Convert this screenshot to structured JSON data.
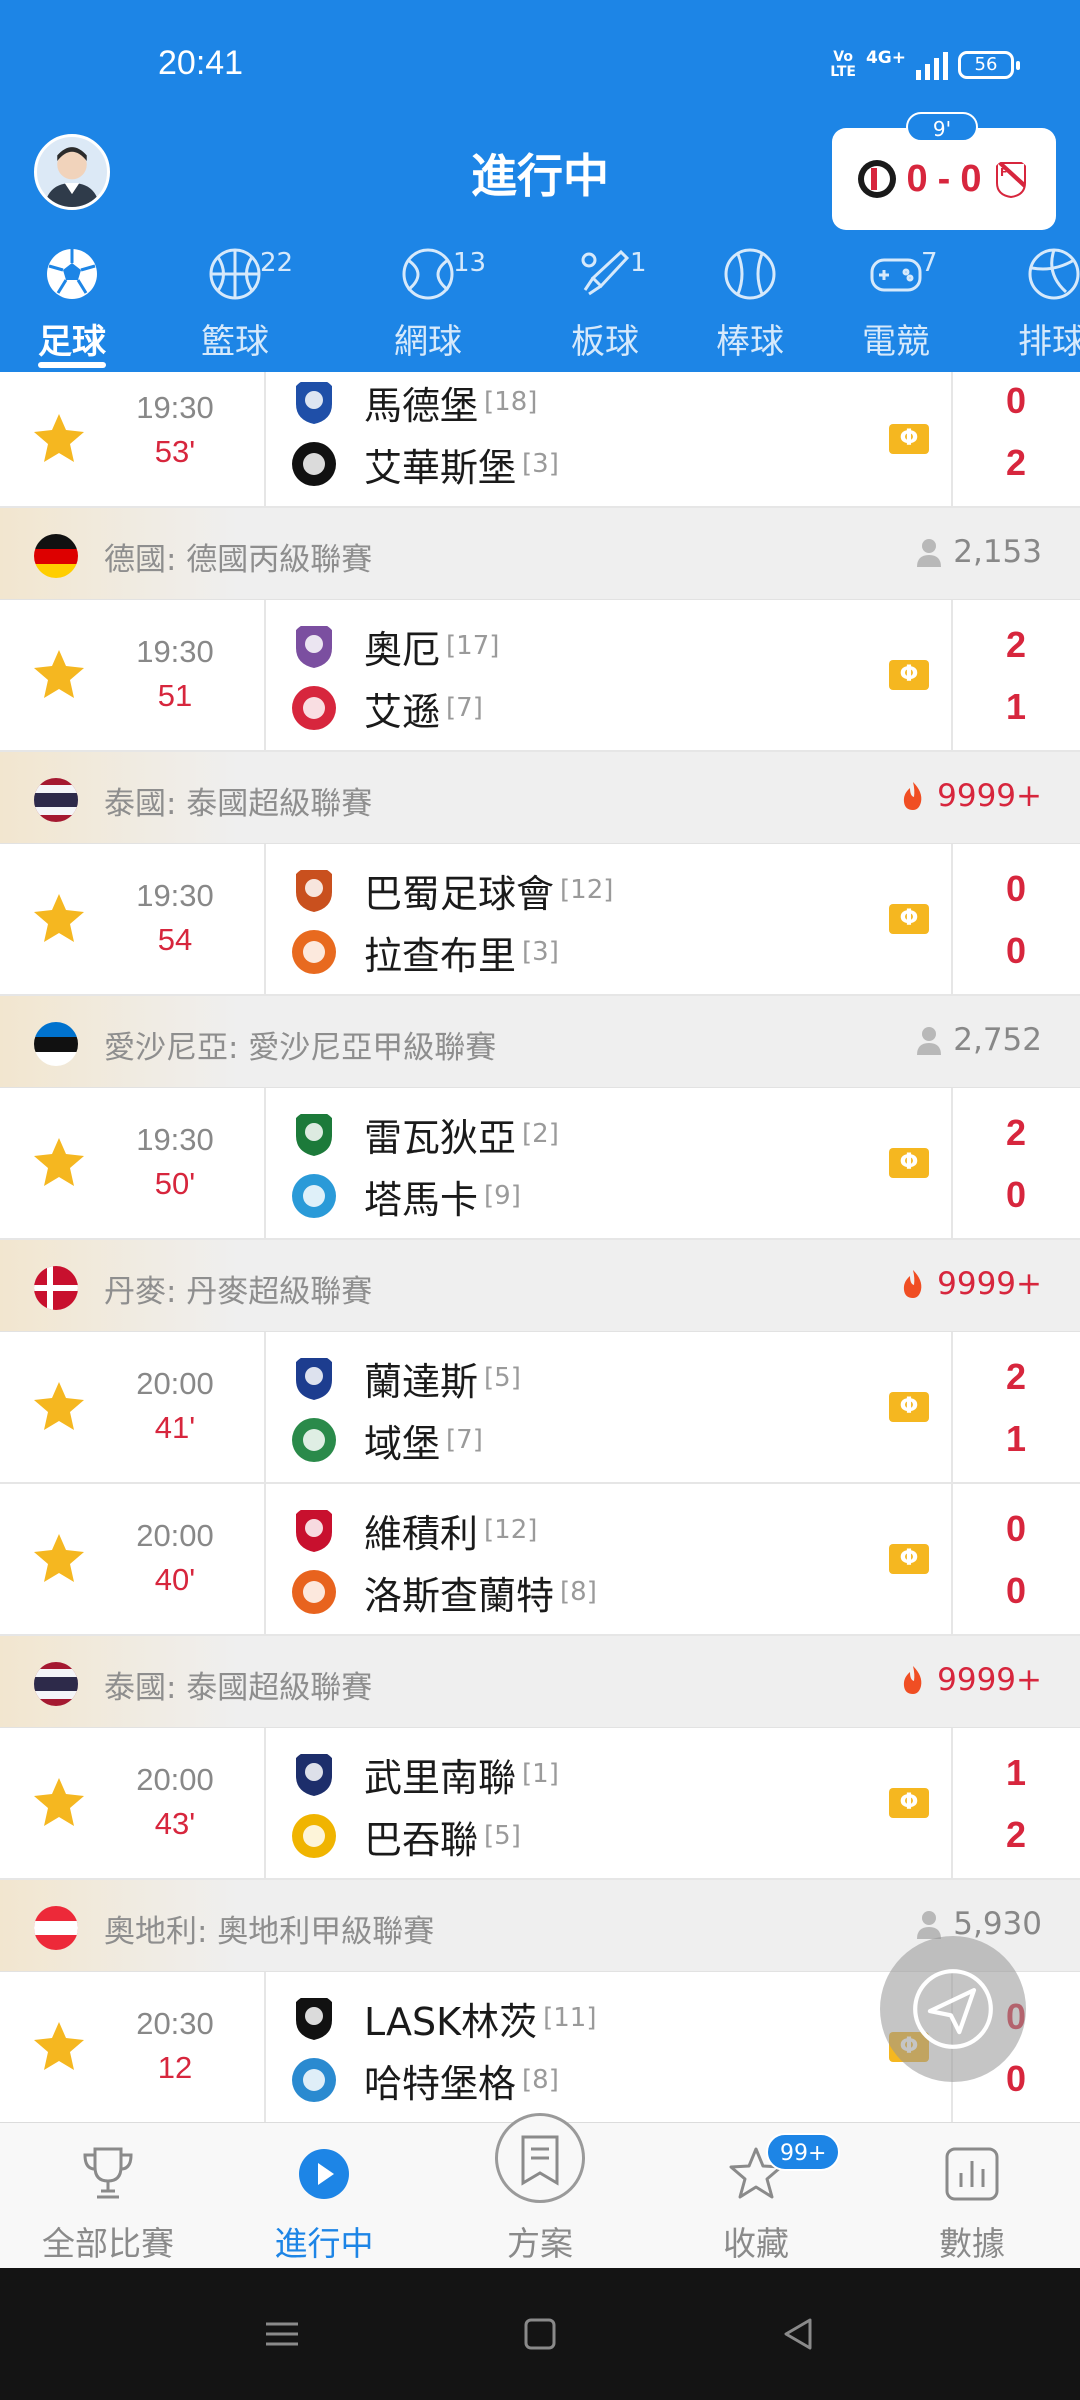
{
  "status_bar": {
    "time": "20:41",
    "volte": "Vo\nLTE",
    "network": "4G+",
    "battery": "56"
  },
  "header": {
    "title": "進行中",
    "live_card": {
      "minute": "9'",
      "home_score": "0",
      "separator": "-",
      "away_score": "0"
    }
  },
  "sport_tabs": [
    {
      "label": "足球",
      "count": "",
      "icon": "soccer-ball-icon"
    },
    {
      "label": "籃球",
      "count": "22",
      "icon": "basketball-icon"
    },
    {
      "label": "網球",
      "count": "13",
      "icon": "tennis-icon"
    },
    {
      "label": "板球",
      "count": "1",
      "icon": "cricket-icon"
    },
    {
      "label": "棒球",
      "count": "",
      "icon": "baseball-icon"
    },
    {
      "label": "電競",
      "count": "7",
      "icon": "gamepad-icon"
    },
    {
      "label": "排球",
      "count": "",
      "icon": "volleyball-icon"
    }
  ],
  "list": [
    {
      "kind": "match",
      "partial": true,
      "time": "19:30",
      "minute": "53'",
      "home": {
        "name": "馬德堡",
        "rank": "[18]"
      },
      "away": {
        "name": "艾華斯堡",
        "rank": "[3]"
      },
      "home_score": "0",
      "away_score": "2"
    },
    {
      "kind": "league",
      "flag": "germany",
      "name": "德國: 德國丙級聯賽",
      "stat": "2,153",
      "stat_type": "viewers"
    },
    {
      "kind": "match",
      "time": "19:30",
      "minute": "51",
      "home": {
        "name": "奧厄",
        "rank": "[17]"
      },
      "away": {
        "name": "艾遜",
        "rank": "[7]"
      },
      "home_score": "2",
      "away_score": "1"
    },
    {
      "kind": "league",
      "flag": "thailand",
      "name": "泰國: 泰國超級聯賽",
      "stat": "9999+",
      "stat_type": "hot"
    },
    {
      "kind": "match",
      "time": "19:30",
      "minute": "54",
      "home": {
        "name": "巴蜀足球會",
        "rank": "[12]"
      },
      "away": {
        "name": "拉查布里",
        "rank": "[3]"
      },
      "home_score": "0",
      "away_score": "0"
    },
    {
      "kind": "league",
      "flag": "estonia",
      "name": "愛沙尼亞: 愛沙尼亞甲級聯賽",
      "stat": "2,752",
      "stat_type": "viewers"
    },
    {
      "kind": "match",
      "time": "19:30",
      "minute": "50'",
      "home": {
        "name": "雷瓦狄亞",
        "rank": "[2]"
      },
      "away": {
        "name": "塔馬卡",
        "rank": "[9]"
      },
      "home_score": "2",
      "away_score": "0"
    },
    {
      "kind": "league",
      "flag": "denmark",
      "name": "丹麥: 丹麥超級聯賽",
      "stat": "9999+",
      "stat_type": "hot"
    },
    {
      "kind": "match",
      "time": "20:00",
      "minute": "41'",
      "home": {
        "name": "蘭達斯",
        "rank": "[5]"
      },
      "away": {
        "name": "域堡",
        "rank": "[7]"
      },
      "home_score": "2",
      "away_score": "1"
    },
    {
      "kind": "match",
      "time": "20:00",
      "minute": "40'",
      "home": {
        "name": "維積利",
        "rank": "[12]"
      },
      "away": {
        "name": "洛斯查蘭特",
        "rank": "[8]"
      },
      "home_score": "0",
      "away_score": "0"
    },
    {
      "kind": "league",
      "flag": "thailand",
      "name": "泰國: 泰國超級聯賽",
      "stat": "9999+",
      "stat_type": "hot"
    },
    {
      "kind": "match",
      "time": "20:00",
      "minute": "43'",
      "home": {
        "name": "武里南聯",
        "rank": "[1]"
      },
      "away": {
        "name": "巴吞聯",
        "rank": "[5]"
      },
      "home_score": "1",
      "away_score": "2"
    },
    {
      "kind": "league",
      "flag": "austria",
      "name": "奧地利: 奧地利甲級聯賽",
      "stat": "5,930",
      "stat_type": "viewers"
    },
    {
      "kind": "match",
      "time": "20:30",
      "minute": "12",
      "home": {
        "name": "LASK林茨",
        "rank": "[11]"
      },
      "away": {
        "name": "哈特堡格",
        "rank": "[8]"
      },
      "home_score": "0",
      "away_score": "0"
    }
  ],
  "bottom_nav": [
    {
      "label": "全部比賽",
      "icon": "trophy-icon",
      "badge": ""
    },
    {
      "label": "進行中",
      "icon": "play-icon",
      "badge": ""
    },
    {
      "label": "方案",
      "icon": "plan-icon",
      "badge": ""
    },
    {
      "label": "收藏",
      "icon": "star-icon",
      "badge": "99+"
    },
    {
      "label": "數據",
      "icon": "bar-chart-icon",
      "badge": ""
    }
  ],
  "colors": {
    "brand_blue": "#1d85e6",
    "score_red": "#d7263d",
    "star_gold": "#f5b720",
    "league_row_bg": "#efefef"
  }
}
